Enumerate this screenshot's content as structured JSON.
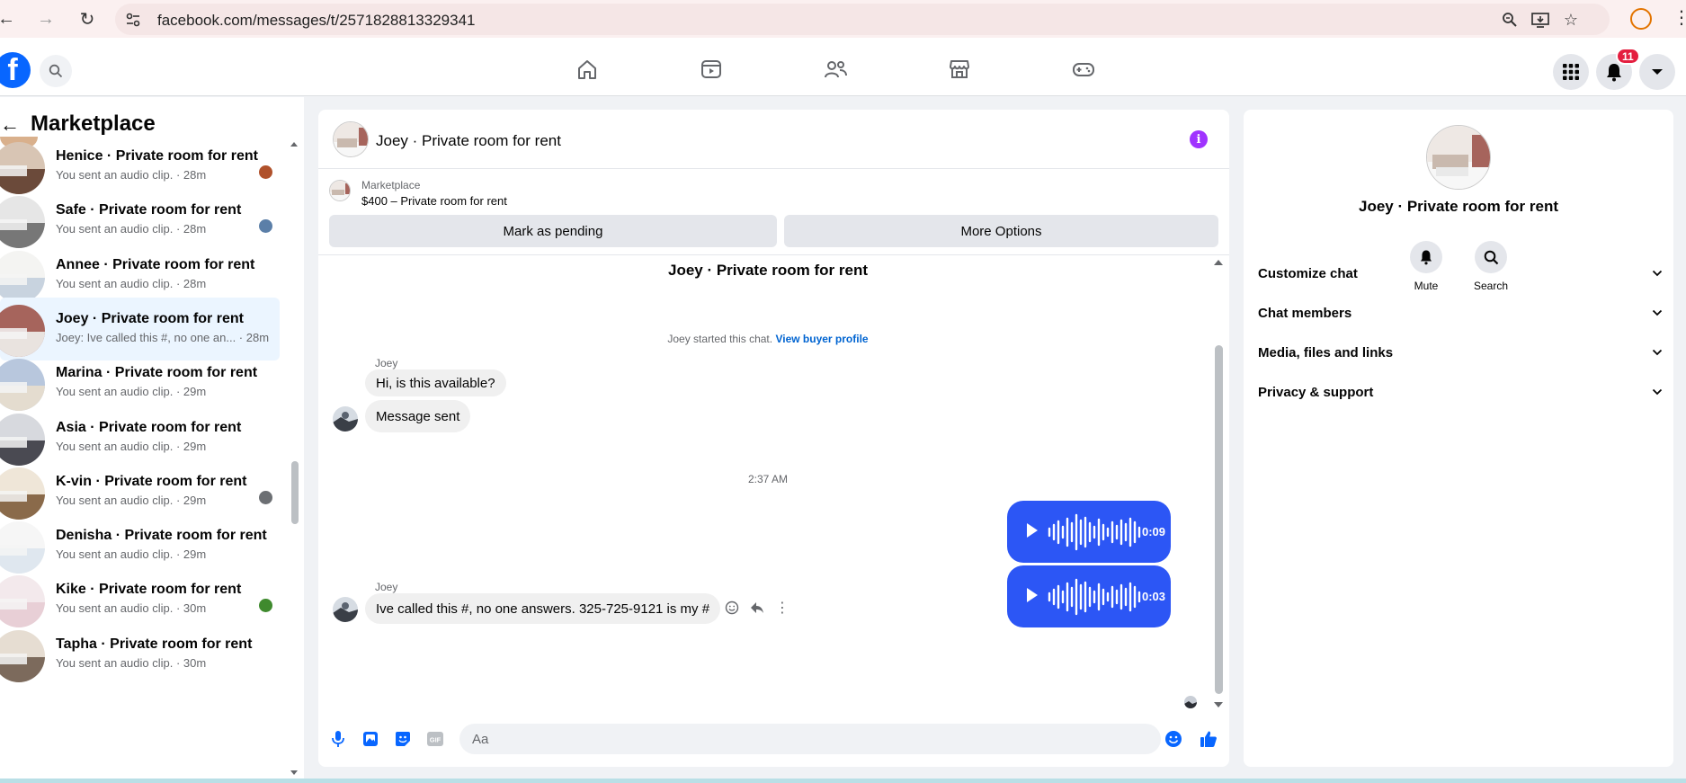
{
  "browser": {
    "url": "facebook.com/messages/t/2571828813329341"
  },
  "topbar": {
    "notification_count": "11"
  },
  "sidebar": {
    "title": "Marketplace",
    "conversations": [
      {
        "title": "Henice · Private room for rent",
        "subtitle": "You sent an audio clip. · 28m",
        "active": false
      },
      {
        "title": "Safe · Private room for rent",
        "subtitle": "You sent an audio clip. · 28m",
        "active": false
      },
      {
        "title": "Annee · Private room for rent",
        "subtitle": "You sent an audio clip. · 28m",
        "active": false
      },
      {
        "title": "Joey · Private room for rent",
        "subtitle": "Joey: Ive called this #, no one an... · 28m",
        "active": true
      },
      {
        "title": "Marina · Private room for rent",
        "subtitle": "You sent an audio clip. · 29m",
        "active": false
      },
      {
        "title": "Asia · Private room for rent",
        "subtitle": "You sent an audio clip. · 29m",
        "active": false
      },
      {
        "title": "K-vin · Private room for rent",
        "subtitle": "You sent an audio clip. · 29m",
        "active": false
      },
      {
        "title": "Denisha · Private room for rent",
        "subtitle": "You sent an audio clip. · 29m",
        "active": false
      },
      {
        "title": "Kike · Private room for rent",
        "subtitle": "You sent an audio clip. · 30m",
        "active": false
      },
      {
        "title": "Tapha · Private room for rent",
        "subtitle": "You sent an audio clip. · 30m",
        "active": false
      }
    ]
  },
  "chat": {
    "header_title": "Joey · Private room for rent",
    "listing": {
      "label": "Marketplace",
      "price_title": "$400 – Private room for rent",
      "mark_pending_label": "Mark as pending",
      "more_options_label": "More Options"
    },
    "thread_title": "Joey · Private room for rent",
    "system_note": "Joey started this chat.",
    "system_link": "View buyer profile",
    "sender_name": "Joey",
    "messages_in_1": [
      "Hi, is this available?",
      "Message sent"
    ],
    "timestamp": "2:37 AM",
    "audio_clips": [
      {
        "duration": "0:09"
      },
      {
        "duration": "0:03"
      }
    ],
    "sender_name_2": "Joey",
    "message_in_2": "Ive called this #, no one answers. 325-725-9121 is my #",
    "composer_placeholder": "Aa"
  },
  "info_panel": {
    "name": "Joey · Private room for rent",
    "mute_label": "Mute",
    "search_label": "Search",
    "sections": [
      "Customize chat",
      "Chat members",
      "Media, files and links",
      "Privacy & support"
    ]
  },
  "colors": {
    "accent": "#0866ff",
    "audio_bubble": "#2c56f5",
    "active_row": "#ebf5ff",
    "info_icon": "#a033ff"
  }
}
